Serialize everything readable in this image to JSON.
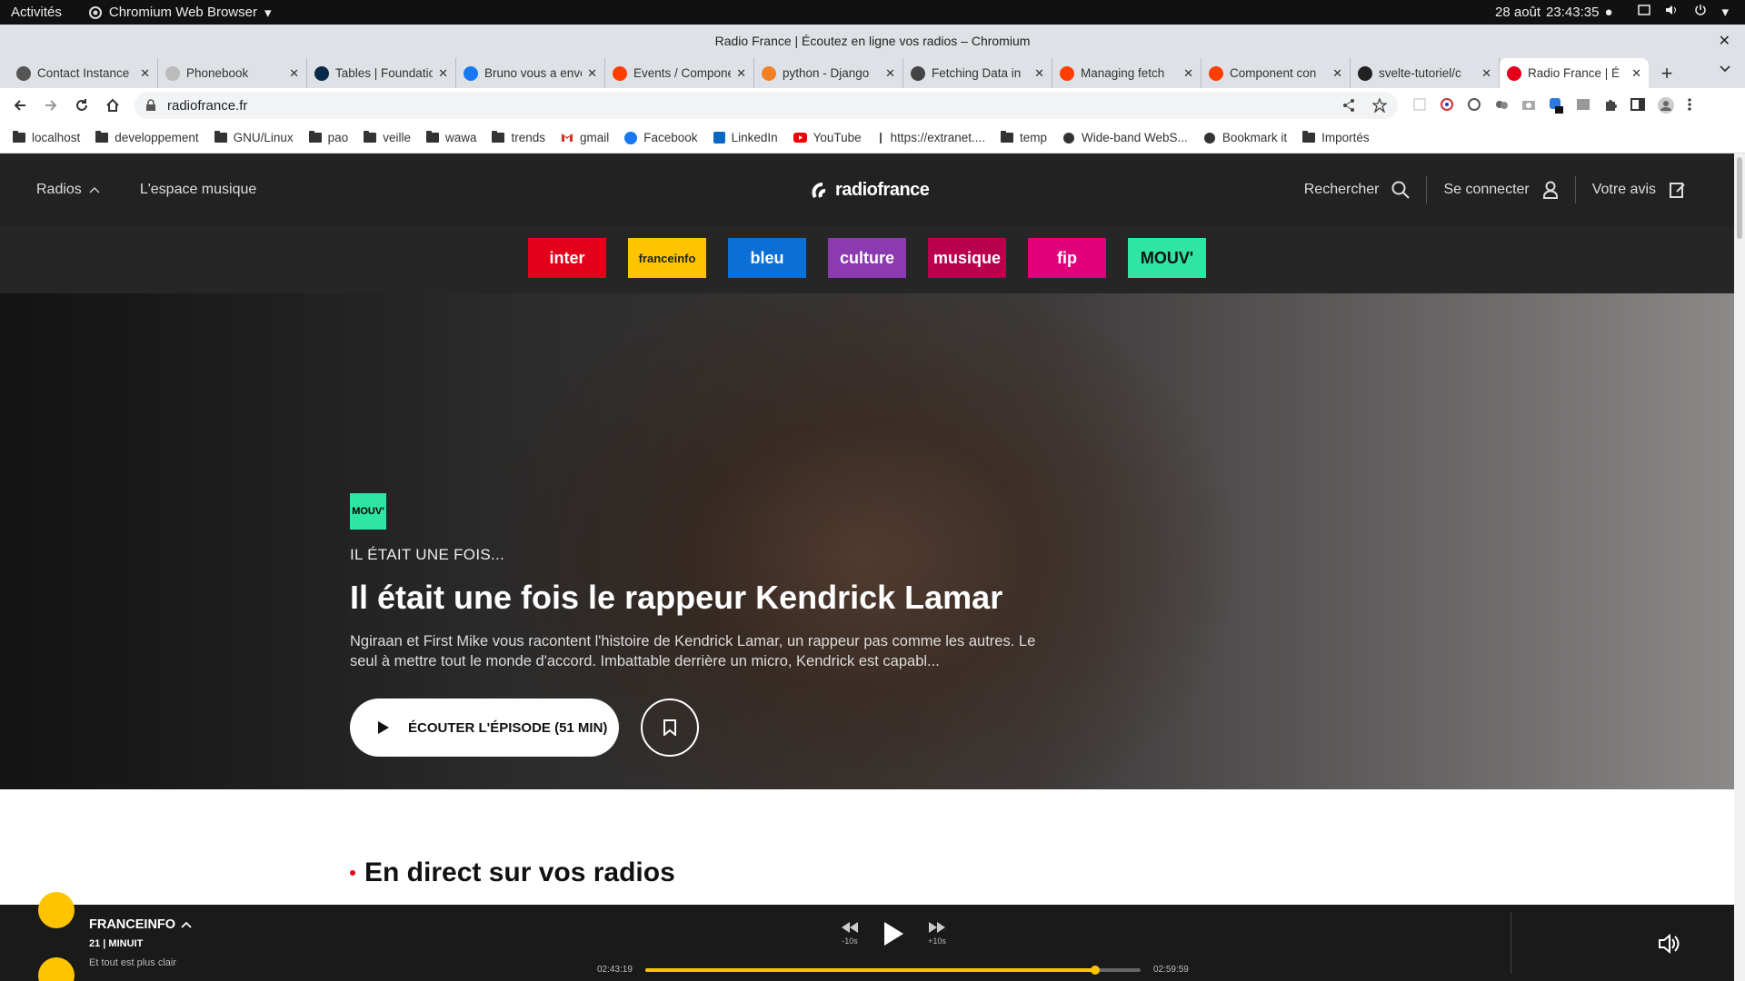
{
  "os": {
    "activities": "Activités",
    "app_name": "Chromium Web Browser",
    "date": "28 août",
    "time": "23:43:35"
  },
  "window": {
    "title": "Radio France | Écoutez en ligne vos radios – Chromium"
  },
  "tabs": [
    {
      "label": "Contact Instance",
      "color": "#555"
    },
    {
      "label": "Phonebook",
      "color": "#bbb"
    },
    {
      "label": "Tables | Foundation",
      "color": "#0a2a4a"
    },
    {
      "label": "Bruno vous a envoyé",
      "color": "#1877f2"
    },
    {
      "label": "Events / Components",
      "color": "#ff3e00"
    },
    {
      "label": "python - Django",
      "color": "#f48024"
    },
    {
      "label": "Fetching Data in",
      "color": "#444"
    },
    {
      "label": "Managing fetch",
      "color": "#ff3e00"
    },
    {
      "label": "Component con",
      "color": "#ff3e00"
    },
    {
      "label": "svelte-tutoriel/c",
      "color": "#222"
    },
    {
      "label": "Radio France | É",
      "color": "#e3001b"
    }
  ],
  "address": {
    "url": "radiofrance.fr"
  },
  "bookmarks": [
    {
      "label": "localhost",
      "icon": "folder"
    },
    {
      "label": "developpement",
      "icon": "folder"
    },
    {
      "label": "GNU/Linux",
      "icon": "folder"
    },
    {
      "label": "pao",
      "icon": "folder"
    },
    {
      "label": "veille",
      "icon": "folder"
    },
    {
      "label": "wawa",
      "icon": "folder"
    },
    {
      "label": "trends",
      "icon": "folder"
    },
    {
      "label": "gmail",
      "icon": "gmail"
    },
    {
      "label": "Facebook",
      "icon": "facebook"
    },
    {
      "label": "LinkedIn",
      "icon": "linkedin"
    },
    {
      "label": "YouTube",
      "icon": "youtube"
    },
    {
      "label": "https://extranet....",
      "icon": "page"
    },
    {
      "label": "temp",
      "icon": "folder"
    },
    {
      "label": "Wide-band WebS...",
      "icon": "globe"
    },
    {
      "label": "Bookmark it",
      "icon": "globe"
    },
    {
      "label": "Importés",
      "icon": "folder"
    }
  ],
  "site": {
    "nav": {
      "radios": "Radios",
      "music": "L'espace musique",
      "logo": "radiofrance",
      "search": "Rechercher",
      "login": "Se connecter",
      "feedback": "Votre avis"
    },
    "stations": [
      {
        "label": "inter",
        "color": "#e3001b",
        "text": "#ffffff"
      },
      {
        "label": "franceinfo",
        "color": "#ffc400",
        "text": "#222222"
      },
      {
        "label": "bleu",
        "color": "#0b6fd6",
        "text": "#ffffff"
      },
      {
        "label": "culture",
        "color": "#8c3ab0",
        "text": "#ffffff"
      },
      {
        "label": "musique",
        "color": "#b8004f",
        "text": "#ffffff"
      },
      {
        "label": "fip",
        "color": "#e2007a",
        "text": "#ffffff"
      },
      {
        "label": "MOUV'",
        "color": "#2ee5a4",
        "text": "#111111"
      }
    ],
    "hero": {
      "badge": "MOUV'",
      "kicker": "IL ÉTAIT UNE FOIS...",
      "title": "Il était une fois le rappeur Kendrick Lamar",
      "description": "Ngiraan et First Mike vous racontent l'histoire de Kendrick Lamar, un rappeur pas comme les autres. Le seul à mettre tout le monde d'accord. Imbattable derrière un micro, Kendrick est capabl...",
      "listen": "ÉCOUTER L'ÉPISODE (51 MIN)"
    },
    "live_title": "En direct sur vos radios"
  },
  "player": {
    "station": "FRANCEINFO",
    "show": "21 | MINUIT",
    "subtitle": "Et tout est plus clair",
    "back": "-10s",
    "forward": "+10s",
    "elapsed": "02:43:19",
    "total": "02:59:59",
    "progress": 0.908,
    "accent": "#ffc400"
  }
}
